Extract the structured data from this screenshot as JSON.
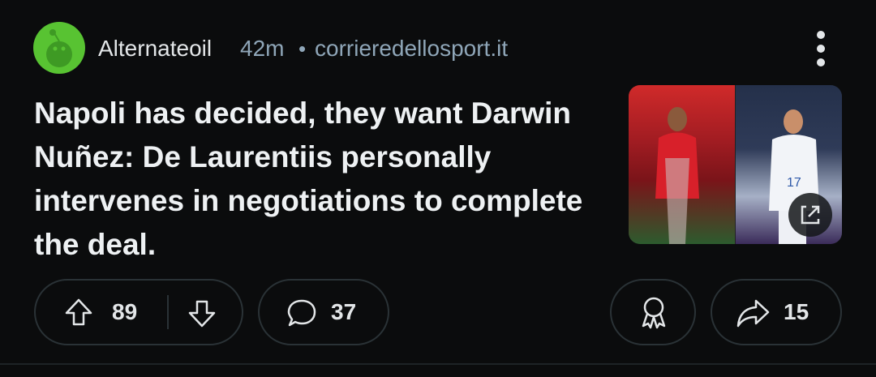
{
  "post": {
    "author": "Alternateoil",
    "time": "42m",
    "separator": "•",
    "domain": "corrieredellosport.it",
    "title": "Napoli has decided, they want Darwin Nuñez: De Laurentiis personally intervenes in negotiations to complete the deal.",
    "avatar_icon": "reddit-snoo-icon",
    "menu_icon": "more-vertical-icon",
    "thumbnail_overlay_icon": "external-link-icon"
  },
  "actions": {
    "upvotes": "89",
    "comments": "37",
    "shares": "15",
    "upvote_icon": "arrow-up-icon",
    "downvote_icon": "arrow-down-icon",
    "comment_icon": "comment-bubble-icon",
    "award_icon": "award-icon",
    "share_icon": "share-arrow-icon"
  },
  "colors": {
    "background": "#0b0c0d",
    "avatar": "#58c332",
    "meta_text": "#8fa6b8",
    "title_text": "#eef1f3",
    "pill_border": "#2a3236"
  }
}
